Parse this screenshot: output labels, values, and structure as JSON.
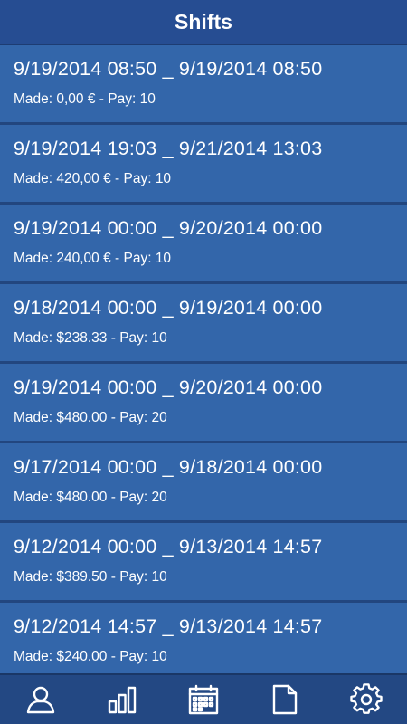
{
  "header": {
    "title": "Shifts"
  },
  "shifts": [
    {
      "range": "9/19/2014 08:50 _ 9/19/2014 08:50",
      "made": "Made: 0,00 € - Pay: 10"
    },
    {
      "range": "9/19/2014 19:03 _ 9/21/2014 13:03",
      "made": "Made: 420,00 € - Pay: 10"
    },
    {
      "range": "9/19/2014 00:00 _ 9/20/2014 00:00",
      "made": "Made: 240,00 € - Pay: 10"
    },
    {
      "range": "9/18/2014 00:00 _ 9/19/2014 00:00",
      "made": "Made: $238.33 - Pay: 10"
    },
    {
      "range": "9/19/2014 00:00 _ 9/20/2014 00:00",
      "made": "Made: $480.00 - Pay: 20"
    },
    {
      "range": "9/17/2014 00:00 _ 9/18/2014 00:00",
      "made": "Made: $480.00 - Pay: 20"
    },
    {
      "range": "9/12/2014 00:00 _ 9/13/2014 14:57",
      "made": "Made: $389.50 - Pay: 10"
    },
    {
      "range": "9/12/2014 14:57 _ 9/13/2014 14:57",
      "made": "Made: $240.00 - Pay: 10"
    }
  ],
  "tabbar": {
    "tabs": [
      {
        "icon": "profile-icon"
      },
      {
        "icon": "bar-chart-icon"
      },
      {
        "icon": "calendar-icon"
      },
      {
        "icon": "document-icon"
      },
      {
        "icon": "gear-icon"
      }
    ]
  },
  "colors": {
    "header_bg": "#264d92",
    "row_bg": "#3366aa",
    "row_separator": "#22467f",
    "tabbar_bg": "#234883",
    "text": "#ffffff"
  }
}
